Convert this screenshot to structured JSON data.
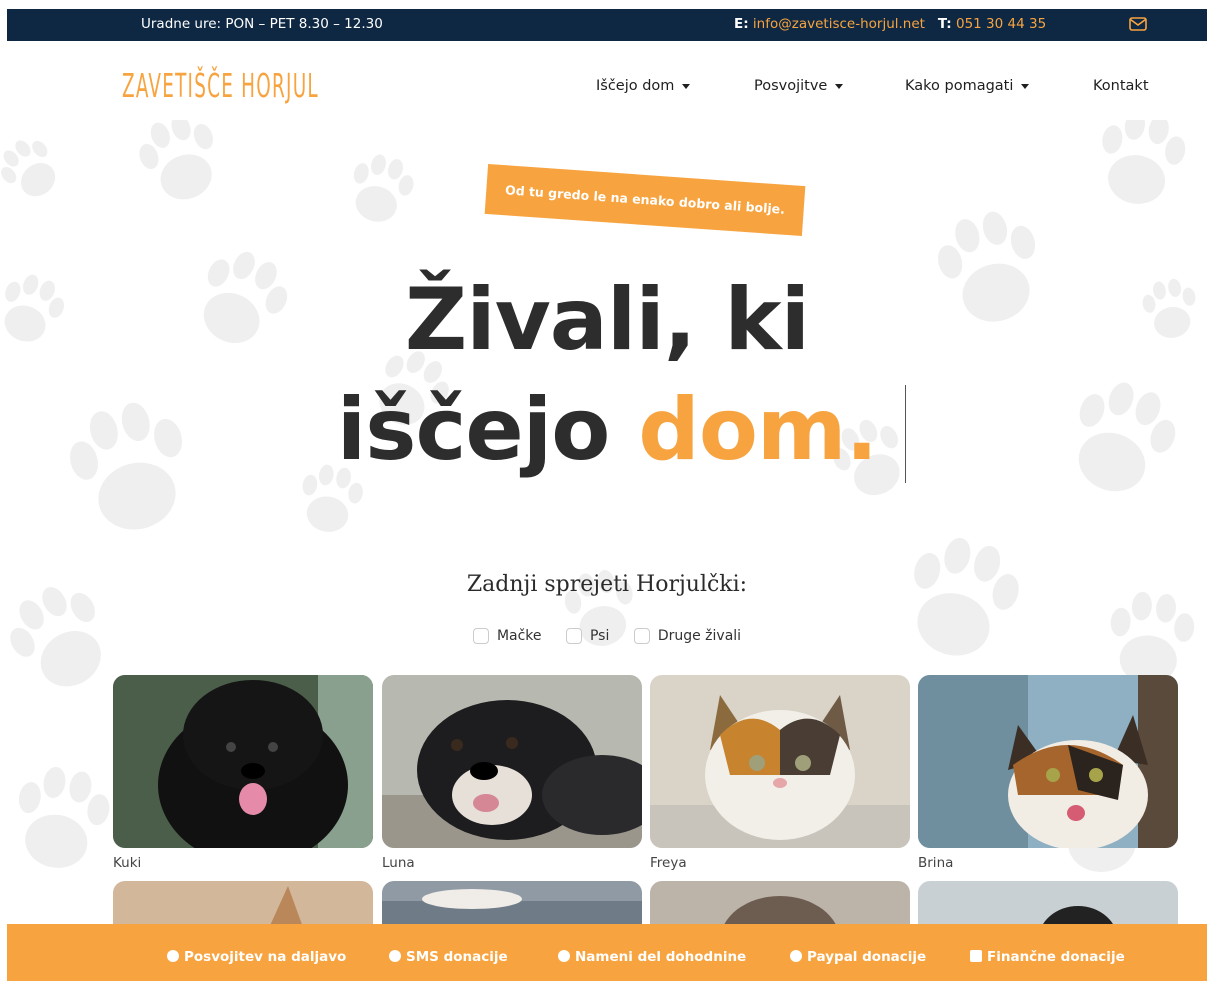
{
  "topbar": {
    "hours": "Uradne ure: PON – PET 8.30 – 12.30",
    "email_label": "E:",
    "email": "info@zavetisce-horjul.net",
    "phone_label": "T:",
    "phone": "051 30 44 35"
  },
  "logo": "ZAVETIŠČE HORJUL",
  "nav": [
    {
      "label": "Iščejo dom"
    },
    {
      "label": "Posvojitve"
    },
    {
      "label": "Kako pomagati"
    },
    {
      "label": "Kontakt"
    }
  ],
  "hero": {
    "ribbon": "Od tu gredo le na enako dobro ali bolje.",
    "line1": "Živali, ki",
    "line2a": "iščejo",
    "line2b": "dom."
  },
  "section": {
    "title": "Zadnji sprejeti Horjulčki:",
    "filters": [
      "Mačke",
      "Psi",
      "Druge živali"
    ]
  },
  "animals": [
    {
      "name": "Kuki"
    },
    {
      "name": "Luna"
    },
    {
      "name": "Freya"
    },
    {
      "name": "Brina"
    }
  ],
  "bottombar": [
    {
      "label": "Posvojitev na daljavo"
    },
    {
      "label": "SMS donacije"
    },
    {
      "label": "Nameni del dohodnine"
    },
    {
      "label": "Paypal donacije"
    },
    {
      "label": "Finančne donacije"
    }
  ],
  "colors": {
    "accent": "#f7a440",
    "navy": "#0e2742"
  }
}
